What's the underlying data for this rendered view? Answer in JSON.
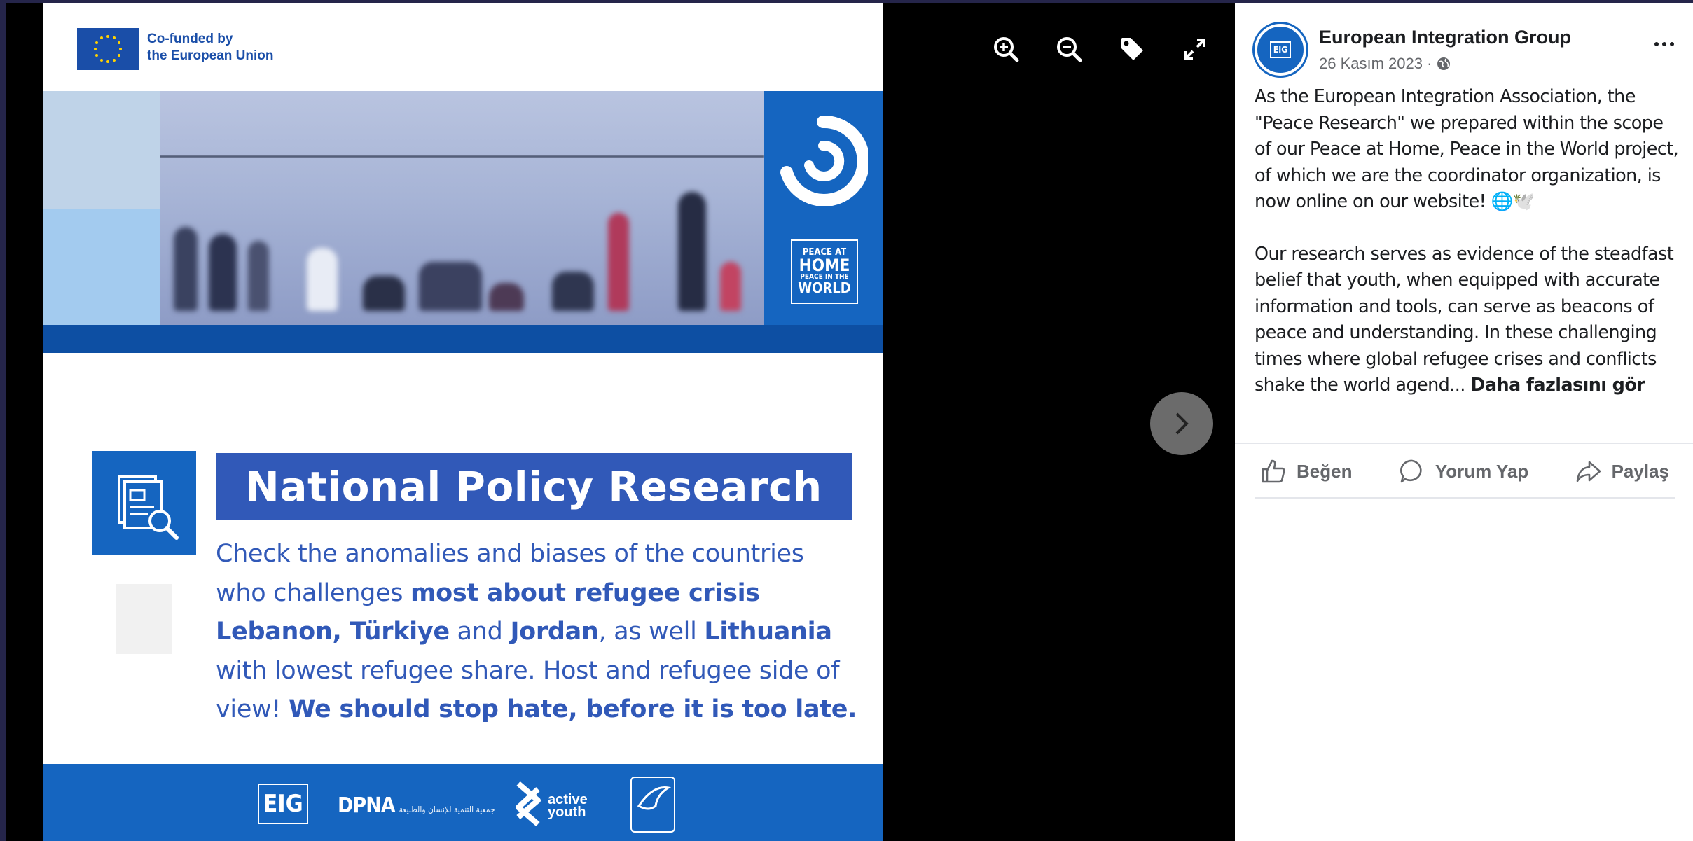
{
  "poster": {
    "eu_line1": "Co-funded by",
    "eu_line2": "the European Union",
    "badge": {
      "l1": "PEACE AT",
      "l2": "HOME",
      "l3": "PEACE IN THE",
      "l4": "WORLD"
    },
    "title": "National Policy Research",
    "body": {
      "t1": "Check the anomalies and biases of the countries who challenges ",
      "b1": "most about refugee crisis Lebanon, Türkiye",
      "t2": " and ",
      "b2": "Jordan",
      "t3": ", as well ",
      "b3": "Lithuania",
      "t4": " with lowest refugee share. Host and refugee side of view! ",
      "b4": "We should stop hate, before it is too late."
    },
    "logos": {
      "eig": "EIG",
      "dpna": "DPNA",
      "dpna_sub": "جمعية التنمية للإنسان والطبيعة",
      "active_1": "active",
      "active_2": "youth"
    }
  },
  "viewer": {
    "tools": [
      "zoom-in-icon",
      "zoom-out-icon",
      "tag-icon",
      "fullscreen-icon"
    ]
  },
  "panel": {
    "avatar_text": "EIG",
    "page_name": "European Integration Group",
    "date": "26 Kasım 2023 ·",
    "paragraph1": "As the European Integration Association, the \"Peace Research\" we prepared within the scope of our Peace at Home, Peace in the World project, of which we are the coordinator organization, is now online on our website! 🌐🕊️",
    "paragraph2": "Our research serves as evidence of the steadfast belief that youth, when equipped with accurate information and tools, can serve as beacons of peace and understanding. In these challenging times where global refugee crises and conflicts shake the world agend... ",
    "see_more": "Daha fazlasını gör",
    "actions": {
      "like": "Beğen",
      "comment": "Yorum Yap",
      "share": "Paylaş"
    }
  },
  "colors": {
    "brand_blue": "#1565c0",
    "banner_blue": "#3159b8",
    "text_dark": "#1c1e21",
    "text_muted": "#65676b"
  }
}
